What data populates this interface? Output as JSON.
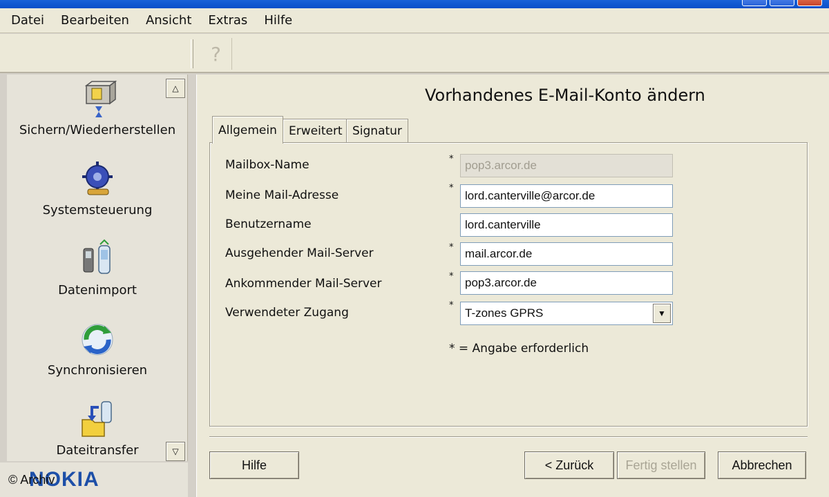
{
  "menu": [
    {
      "label": "Datei"
    },
    {
      "label": "Bearbeiten"
    },
    {
      "label": "Ansicht"
    },
    {
      "label": "Extras"
    },
    {
      "label": "Hilfe"
    }
  ],
  "toolbar": {
    "help_glyph": "?"
  },
  "sidebar": {
    "items": [
      {
        "label": "Sichern/Wiederherstellen",
        "icon": "backup-icon"
      },
      {
        "label": "Systemsteuerung",
        "icon": "control-panel-icon"
      },
      {
        "label": "Datenimport",
        "icon": "data-import-icon"
      },
      {
        "label": "Synchronisieren",
        "icon": "sync-icon"
      },
      {
        "label": "Dateitransfer",
        "icon": "file-transfer-icon"
      }
    ],
    "brand": "NOKIA",
    "watermark": "© Archiv"
  },
  "dialog": {
    "title": "Vorhandenes E-Mail-Konto ändern",
    "tabs": [
      "Allgemein",
      "Erweitert",
      "Signatur"
    ],
    "active_tab": "Allgemein",
    "fields": [
      {
        "label": "Mailbox-Name",
        "value": "pop3.arcor.de",
        "required": true,
        "disabled": true
      },
      {
        "label": "Meine Mail-Adresse",
        "value": "lord.canterville@arcor.de",
        "required": true
      },
      {
        "label": "Benutzername",
        "value": "lord.canterville",
        "required": false
      },
      {
        "label": "Ausgehender Mail-Server",
        "value": "mail.arcor.de",
        "required": true
      },
      {
        "label": "Ankommender Mail-Server",
        "value": "pop3.arcor.de",
        "required": true
      },
      {
        "label": "Verwendeter Zugang",
        "value": "T-zones GPRS",
        "required": true,
        "type": "select"
      }
    ],
    "required_mark": "*",
    "required_note": "* = Angabe erforderlich"
  },
  "buttons": {
    "help": "Hilfe",
    "back": "< Zurück",
    "finish": "Fertig stellen",
    "cancel": "Abbrechen"
  }
}
